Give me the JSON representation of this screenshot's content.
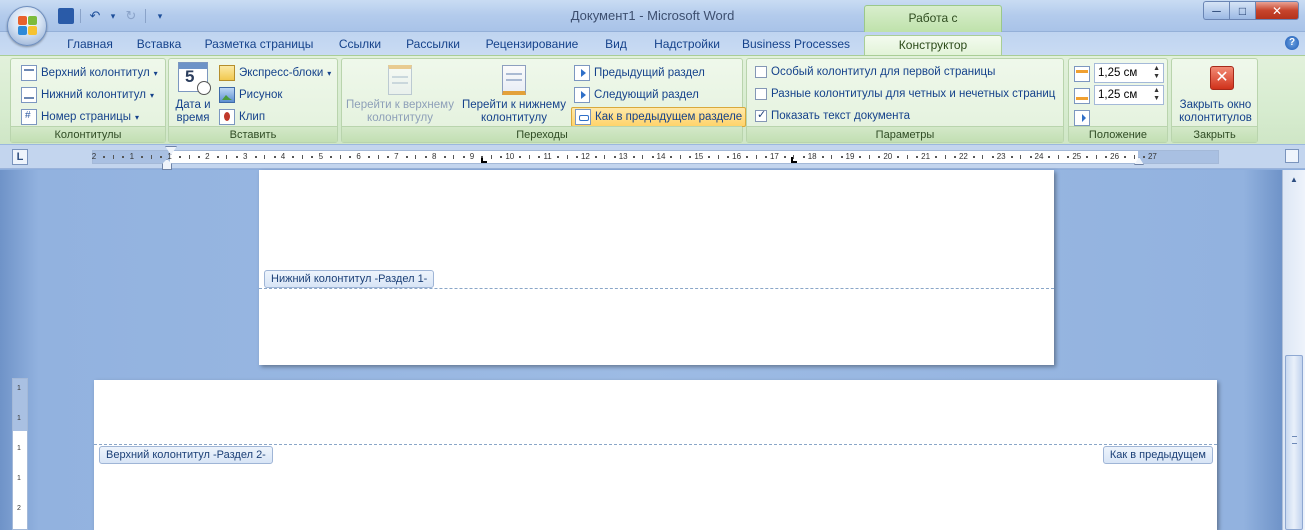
{
  "window": {
    "title": "Документ1 - Microsoft Word",
    "context_tab": "Работа с колонтитулами",
    "buttons": {
      "minimize": "─",
      "maximize": "□",
      "close": "✕"
    }
  },
  "qat": {
    "save": "save-icon",
    "undo": "↶",
    "undo_arrow": "▾",
    "redo": "↻",
    "customize": "▾"
  },
  "tabs": [
    {
      "label": "Главная"
    },
    {
      "label": "Вставка"
    },
    {
      "label": "Разметка страницы"
    },
    {
      "label": "Ссылки"
    },
    {
      "label": "Рассылки"
    },
    {
      "label": "Рецензирование"
    },
    {
      "label": "Вид"
    },
    {
      "label": "Надстройки"
    },
    {
      "label": "Business Processes"
    },
    {
      "label": "Конструктор",
      "active": true
    }
  ],
  "help": "?",
  "ribbon": {
    "headers_group": {
      "label": "Колонтитулы",
      "header": "Верхний колонтитул",
      "footer": "Нижний колонтитул",
      "page_number": "Номер страницы",
      "arrow": "▾"
    },
    "insert_group": {
      "label": "Вставить",
      "date_time": "Дата и время",
      "calendar_number": "5",
      "quick_parts": "Экспресс-блоки",
      "picture": "Рисунок",
      "clip": "Клип",
      "arrow": "▾"
    },
    "nav_group": {
      "label": "Переходы",
      "goto_header": "Перейти к верхнему колонтитулу",
      "goto_footer": "Перейти к нижнему колонтитулу",
      "prev_section": "Предыдущий раздел",
      "next_section": "Следующий раздел",
      "link_to_previous": "Как в предыдущем разделе"
    },
    "options_group": {
      "label": "Параметры",
      "diff_first": "Особый колонтитул для первой страницы",
      "diff_odd_even": "Разные колонтитулы для четных и нечетных страниц",
      "show_doc_text": "Показать текст документа",
      "states": {
        "diff_first": false,
        "diff_odd_even": false,
        "show_doc_text": true
      }
    },
    "position_group": {
      "label": "Положение",
      "header_pos": "1,25 см",
      "footer_pos": "1,25 см",
      "spin_up": "▲",
      "spin_down": "▼"
    },
    "close_group": {
      "label": "Закрыть",
      "close_button": "Закрыть окно колонтитулов",
      "close_glyph": "✕"
    }
  },
  "ruler": {
    "corner": "L",
    "ticks": [
      "2",
      "1",
      "1",
      "2",
      "3",
      "4",
      "5",
      "6",
      "7",
      "8",
      "9",
      "10",
      "11",
      "12",
      "13",
      "14",
      "15",
      "16",
      "17",
      "18",
      "19",
      "20",
      "21",
      "22",
      "23",
      "24",
      "25",
      "26",
      "27"
    ]
  },
  "vruler": {
    "ticks": [
      "1",
      "1",
      "1",
      "1",
      "2"
    ]
  },
  "document": {
    "footer_tag_s1": "Нижний колонтитул -Раздел 1-",
    "header_tag_s2": "Верхний колонтитул -Раздел 2-",
    "same_as_prev_tag": "Как в предыдущем"
  },
  "scrollbar": {
    "up": "▲"
  },
  "colors": {
    "ribbon_context": "#d7ecd0",
    "title_bar": "#b3cbec",
    "doc_bg": "#9dbbe4"
  }
}
